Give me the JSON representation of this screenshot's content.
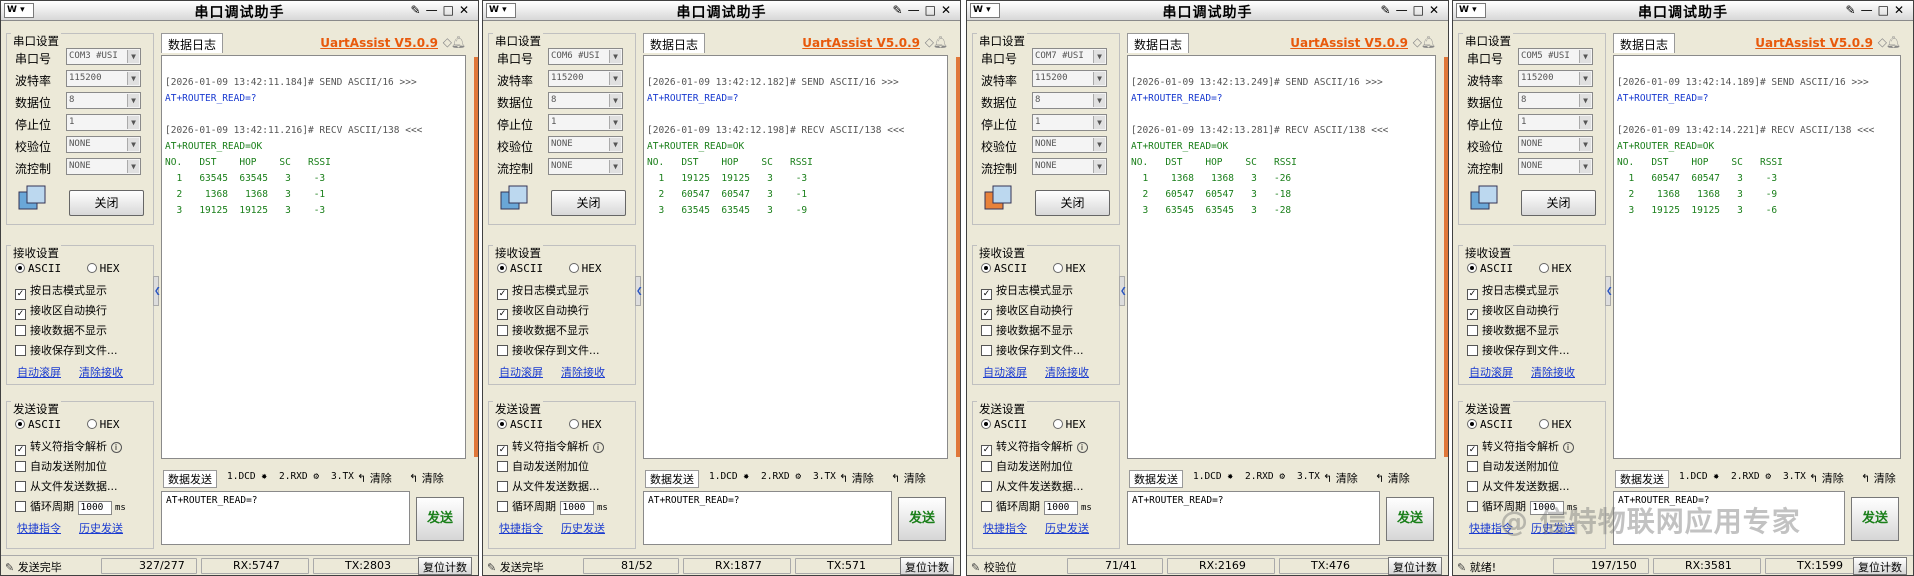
{
  "app_title": "串口调试助手",
  "brand": "UartAssist V5.0.9",
  "logo_text": "W",
  "title_buttons": [
    "✎",
    "—",
    "□",
    "✕"
  ],
  "labels": {
    "serial_settings": "串口设置",
    "port": "串口号",
    "baud": "波特率",
    "databits": "数据位",
    "stopbits": "停止位",
    "parity": "校验位",
    "flow": "流控制",
    "close_button": "关闭",
    "log_tab": "数据日志",
    "recv_settings": "接收设置",
    "ascii": "ASCII",
    "hex": "HEX",
    "recv_log_mode": "按日志模式显示",
    "recv_auto_wrap": "接收区自动换行",
    "recv_hide": "接收数据不显示",
    "recv_save": "接收保存到文件...",
    "auto_scroll": "自动滚屏",
    "clear_recv": "清除接收",
    "send_settings": "发送设置",
    "escape_parse": "转义符指令解析",
    "auto_append": "自动发送附加位",
    "file_send": "从文件发送数据...",
    "cycle": "循环周期",
    "cycle_value": "1000",
    "cycle_unit": "ms",
    "quick_cmd": "快捷指令",
    "history_send": "历史发送",
    "data_send": "数据发送",
    "dcd": "1.DCD",
    "rxd": "2.RXD",
    "tx": "3.TX",
    "clear1": "清除",
    "clear2": "清除",
    "send_button": "发送",
    "reset_count": "复位计数",
    "send_text": "AT+ROUTER_READ=?"
  },
  "table_header": "NO.   DST    HOP    SC   RSSI",
  "windows": [
    {
      "port": "COM3 #USI",
      "baud": "115200",
      "databits": "8",
      "stopbits": "1",
      "parity": "NONE",
      "flow": "NONE",
      "send_ts": "[2026-01-09 13:42:11.184]# SEND ASCII/16 >>>",
      "send_cmd": "AT+ROUTER_READ=?",
      "recv_ts": "[2026-01-09 13:42:11.216]# RECV ASCII/138 <<<",
      "recv_ok": "AT+ROUTER_READ=OK",
      "rows": [
        "  1   63545  63545   3    -3",
        "  2    1368   1368   3    -1",
        "  3   19125  19125   3    -3"
      ],
      "status": "发送完毕",
      "count": "327/277",
      "rx": "RX:5747",
      "tx": "TX:2803"
    },
    {
      "port": "COM6 #USI",
      "baud": "115200",
      "databits": "8",
      "stopbits": "1",
      "parity": "NONE",
      "flow": "NONE",
      "send_ts": "[2026-01-09 13:42:12.182]# SEND ASCII/16 >>>",
      "send_cmd": "AT+ROUTER_READ=?",
      "recv_ts": "[2026-01-09 13:42:12.198]# RECV ASCII/138 <<<",
      "recv_ok": "AT+ROUTER_READ=OK",
      "rows": [
        "  1   19125  19125   3    -3",
        "  2   60547  60547   3    -1",
        "  3   63545  63545   3    -9"
      ],
      "status": "发送完毕",
      "count": "81/52",
      "rx": "RX:1877",
      "tx": "TX:571"
    },
    {
      "port": "COM7 #USI",
      "baud": "115200",
      "databits": "8",
      "stopbits": "1",
      "parity": "NONE",
      "flow": "NONE",
      "send_ts": "[2026-01-09 13:42:13.249]# SEND ASCII/16 >>>",
      "send_cmd": "AT+ROUTER_READ=?",
      "recv_ts": "[2026-01-09 13:42:13.281]# RECV ASCII/138 <<<",
      "recv_ok": "AT+ROUTER_READ=OK",
      "rows": [
        "  1    1368   1368   3   -26",
        "  2   60547  60547   3   -18",
        "  3   63545  63545   3   -28"
      ],
      "status": "校验位",
      "count": "71/41",
      "rx": "RX:2169",
      "tx": "TX:476"
    },
    {
      "port": "COM5 #USI",
      "baud": "115200",
      "databits": "8",
      "stopbits": "1",
      "parity": "NONE",
      "flow": "NONE",
      "send_ts": "[2026-01-09 13:42:14.189]# SEND ASCII/16 >>>",
      "send_cmd": "AT+ROUTER_READ=?",
      "recv_ts": "[2026-01-09 13:42:14.221]# RECV ASCII/138 <<<",
      "recv_ok": "AT+ROUTER_READ=OK",
      "rows": [
        "  1   60547  60547   3    -3",
        "  2    1368   1368   3    -9",
        "  3   19125  19125   3    -6"
      ],
      "status": "就绪!",
      "count": "197/150",
      "rx": "RX:3581",
      "tx": "TX:1599"
    }
  ],
  "watermark": "@ 信特物联网应用专家",
  "colors": {
    "brand": "#e8590c",
    "link": "#1a3bd0",
    "ok_text": "#1a7f1a",
    "send_text": "#1a3bd0"
  }
}
